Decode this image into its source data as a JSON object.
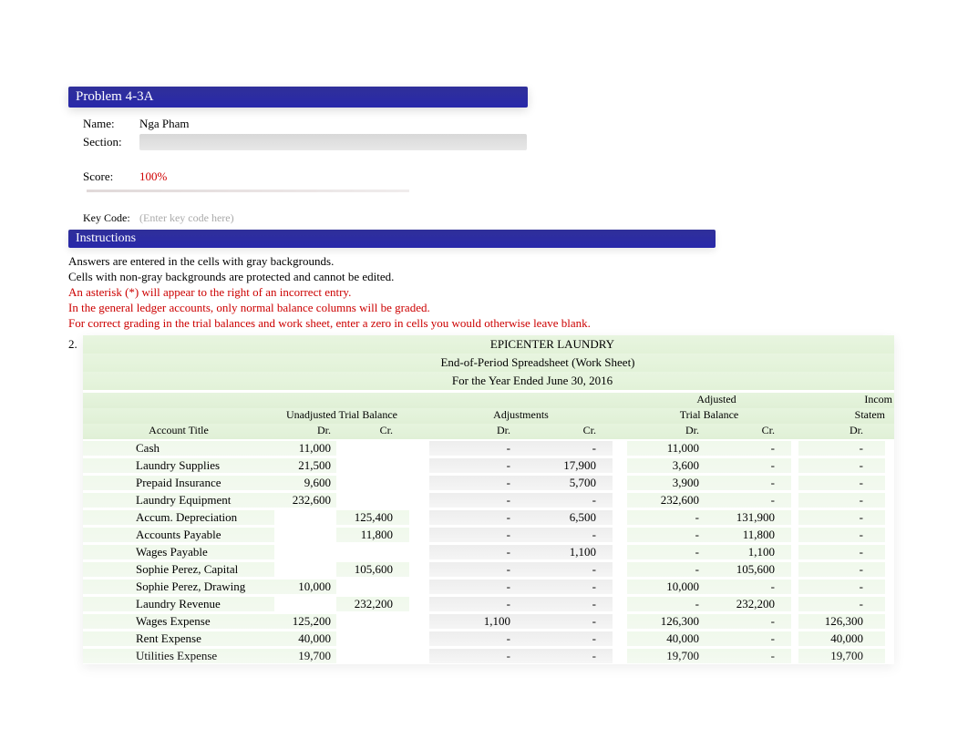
{
  "header": {
    "problem_title": "Problem 4-3A"
  },
  "info": {
    "name_label": "Name:",
    "name_value": "Nga Pham",
    "section_label": "Section:",
    "score_label": "Score:",
    "score_value": "100%",
    "keycode_label": "Key Code:",
    "keycode_placeholder": "(Enter key code here)"
  },
  "instructions": {
    "bar": "Instructions",
    "line1": "Answers are entered in the cells with gray backgrounds.",
    "line2": "Cells with non-gray backgrounds are protected and cannot be edited.",
    "line3": "An asterisk (*) will appear to the right of an incorrect entry.",
    "line4": "In the general ledger accounts, only normal balance columns will be graded.",
    "line5": "For correct grading in the trial balances and work sheet, enter a zero in cells you would otherwise leave blank."
  },
  "section_number": "2.",
  "worksheet": {
    "company": "EPICENTER LAUNDRY",
    "title": "End-of-Period Spreadsheet (Work Sheet)",
    "period": "For the Year Ended June 30, 2016",
    "col_groups": {
      "unadjusted": "Unadjusted Trial Balance",
      "adjustments": "Adjustments",
      "adjusted": "Adjusted",
      "adjusted2": "Trial Balance",
      "income": "Incom",
      "income2": "Statem"
    },
    "col_labels": {
      "account_title": "Account Title",
      "dr": "Dr.",
      "cr": "Cr."
    },
    "rows": [
      {
        "title": "Cash",
        "utb_dr": "11,000",
        "utb_cr": "",
        "adj_dr": "-",
        "adj_cr": "-",
        "atb_dr": "11,000",
        "atb_cr": "-",
        "is_dr": "-"
      },
      {
        "title": "Laundry Supplies",
        "utb_dr": "21,500",
        "utb_cr": "",
        "adj_dr": "-",
        "adj_cr": "17,900",
        "atb_dr": "3,600",
        "atb_cr": "-",
        "is_dr": "-"
      },
      {
        "title": "Prepaid Insurance",
        "utb_dr": "9,600",
        "utb_cr": "",
        "adj_dr": "-",
        "adj_cr": "5,700",
        "atb_dr": "3,900",
        "atb_cr": "-",
        "is_dr": "-"
      },
      {
        "title": "Laundry Equipment",
        "utb_dr": "232,600",
        "utb_cr": "",
        "adj_dr": "-",
        "adj_cr": "-",
        "atb_dr": "232,600",
        "atb_cr": "-",
        "is_dr": "-"
      },
      {
        "title": "Accum. Depreciation",
        "utb_dr": "",
        "utb_cr": "125,400",
        "adj_dr": "-",
        "adj_cr": "6,500",
        "atb_dr": "-",
        "atb_cr": "131,900",
        "is_dr": "-"
      },
      {
        "title": "Accounts Payable",
        "utb_dr": "",
        "utb_cr": "11,800",
        "adj_dr": "-",
        "adj_cr": "-",
        "atb_dr": "-",
        "atb_cr": "11,800",
        "is_dr": "-"
      },
      {
        "title": "Wages Payable",
        "utb_dr": "",
        "utb_cr": "",
        "adj_dr": "-",
        "adj_cr": "1,100",
        "atb_dr": "-",
        "atb_cr": "1,100",
        "is_dr": "-"
      },
      {
        "title": "Sophie Perez, Capital",
        "utb_dr": "",
        "utb_cr": "105,600",
        "adj_dr": "-",
        "adj_cr": "-",
        "atb_dr": "-",
        "atb_cr": "105,600",
        "is_dr": "-"
      },
      {
        "title": "Sophie Perez, Drawing",
        "utb_dr": "10,000",
        "utb_cr": "",
        "adj_dr": "-",
        "adj_cr": "-",
        "atb_dr": "10,000",
        "atb_cr": "-",
        "is_dr": "-"
      },
      {
        "title": "Laundry Revenue",
        "utb_dr": "",
        "utb_cr": "232,200",
        "adj_dr": "-",
        "adj_cr": "-",
        "atb_dr": "-",
        "atb_cr": "232,200",
        "is_dr": "-"
      },
      {
        "title": "Wages Expense",
        "utb_dr": "125,200",
        "utb_cr": "",
        "adj_dr": "1,100",
        "adj_cr": "-",
        "atb_dr": "126,300",
        "atb_cr": "-",
        "is_dr": "126,300"
      },
      {
        "title": "Rent Expense",
        "utb_dr": "40,000",
        "utb_cr": "",
        "adj_dr": "-",
        "adj_cr": "-",
        "atb_dr": "40,000",
        "atb_cr": "-",
        "is_dr": "40,000"
      },
      {
        "title": "Utilities Expense",
        "utb_dr": "19,700",
        "utb_cr": "",
        "adj_dr": "-",
        "adj_cr": "-",
        "atb_dr": "19,700",
        "atb_cr": "-",
        "is_dr": "19,700"
      }
    ]
  },
  "chart_data": {
    "type": "table",
    "title": "EPICENTER LAUNDRY — End-of-Period Spreadsheet (Work Sheet) — For the Year Ended June 30, 2016",
    "columns": [
      "Account Title",
      "Unadjusted Dr.",
      "Unadjusted Cr.",
      "Adjustments Dr.",
      "Adjustments Cr.",
      "Adjusted TB Dr.",
      "Adjusted TB Cr.",
      "Income Stmt Dr."
    ],
    "rows": [
      [
        "Cash",
        11000,
        null,
        0,
        0,
        11000,
        0,
        0
      ],
      [
        "Laundry Supplies",
        21500,
        null,
        0,
        17900,
        3600,
        0,
        0
      ],
      [
        "Prepaid Insurance",
        9600,
        null,
        0,
        5700,
        3900,
        0,
        0
      ],
      [
        "Laundry Equipment",
        232600,
        null,
        0,
        0,
        232600,
        0,
        0
      ],
      [
        "Accum. Depreciation",
        null,
        125400,
        0,
        6500,
        0,
        131900,
        0
      ],
      [
        "Accounts Payable",
        null,
        11800,
        0,
        0,
        0,
        11800,
        0
      ],
      [
        "Wages Payable",
        null,
        null,
        0,
        1100,
        0,
        1100,
        0
      ],
      [
        "Sophie Perez, Capital",
        null,
        105600,
        0,
        0,
        0,
        105600,
        0
      ],
      [
        "Sophie Perez, Drawing",
        10000,
        null,
        0,
        0,
        10000,
        0,
        0
      ],
      [
        "Laundry Revenue",
        null,
        232200,
        0,
        0,
        0,
        232200,
        0
      ],
      [
        "Wages Expense",
        125200,
        null,
        1100,
        0,
        126300,
        0,
        126300
      ],
      [
        "Rent Expense",
        40000,
        null,
        0,
        0,
        40000,
        0,
        40000
      ],
      [
        "Utilities Expense",
        19700,
        null,
        0,
        0,
        19700,
        0,
        19700
      ]
    ]
  }
}
